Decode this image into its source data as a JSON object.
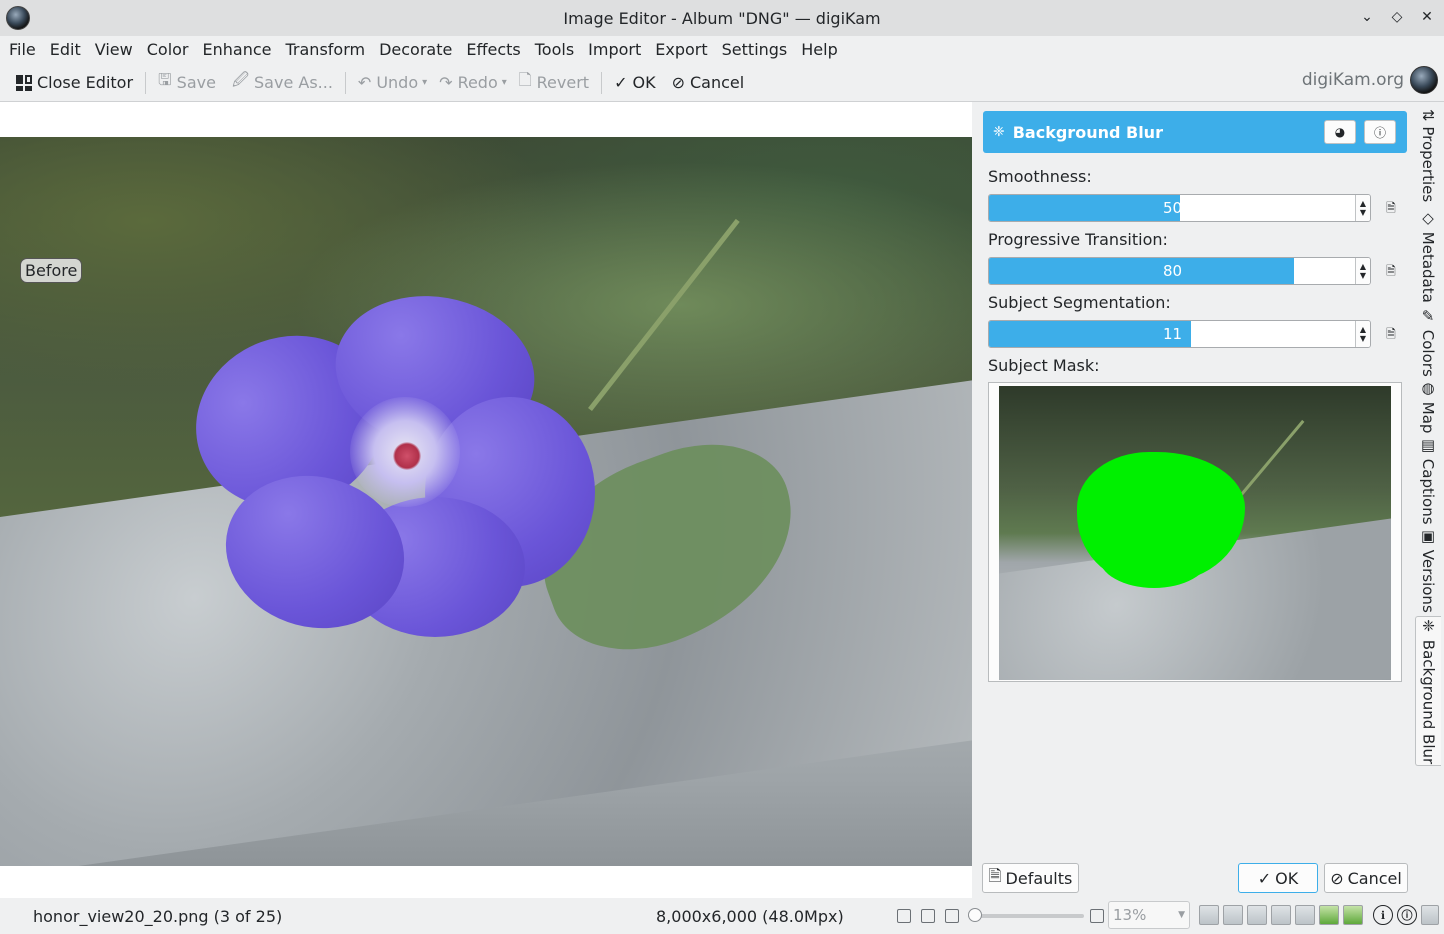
{
  "window": {
    "title": "Image Editor - Album \"DNG\" — digiKam",
    "controls": [
      "⌄",
      "◇",
      "✕"
    ]
  },
  "menu": [
    "File",
    "Edit",
    "View",
    "Color",
    "Enhance",
    "Transform",
    "Decorate",
    "Effects",
    "Tools",
    "Import",
    "Export",
    "Settings",
    "Help"
  ],
  "toolbar": {
    "close_editor": "Close Editor",
    "save": "Save",
    "save_as": "Save As...",
    "undo": "Undo",
    "redo": "Redo",
    "revert": "Revert",
    "ok": "OK",
    "cancel": "Cancel",
    "brand": "digiKam.org"
  },
  "canvas": {
    "before_label": "Before"
  },
  "panel": {
    "title": "Background Blur",
    "smoothness": {
      "label": "Smoothness:",
      "value": "50",
      "fraction": 0.5
    },
    "progressive": {
      "label": "Progressive Transition:",
      "value": "80",
      "fraction": 0.8
    },
    "segmentation": {
      "label": "Subject Segmentation:",
      "value": "11",
      "fraction": 0.53
    },
    "mask_label": "Subject Mask:",
    "defaults": "Defaults",
    "ok": "OK",
    "cancel": "Cancel",
    "accent_color": "#3daee9",
    "mask_color": "#00f000"
  },
  "sidetabs": [
    {
      "label": "Properties",
      "icon": "⇅"
    },
    {
      "label": "Metadata",
      "icon": "◇"
    },
    {
      "label": "Colors",
      "icon": "✎"
    },
    {
      "label": "Map",
      "icon": "◍"
    },
    {
      "label": "Captions",
      "icon": "▤"
    },
    {
      "label": "Versions",
      "icon": "▣"
    },
    {
      "label": "Background Blur",
      "icon": "❈"
    }
  ],
  "status": {
    "file": "honor_view20_20.png (3 of 25)",
    "dimensions": "8,000x6,000 (48.0Mpx)",
    "zoom": "13%"
  }
}
